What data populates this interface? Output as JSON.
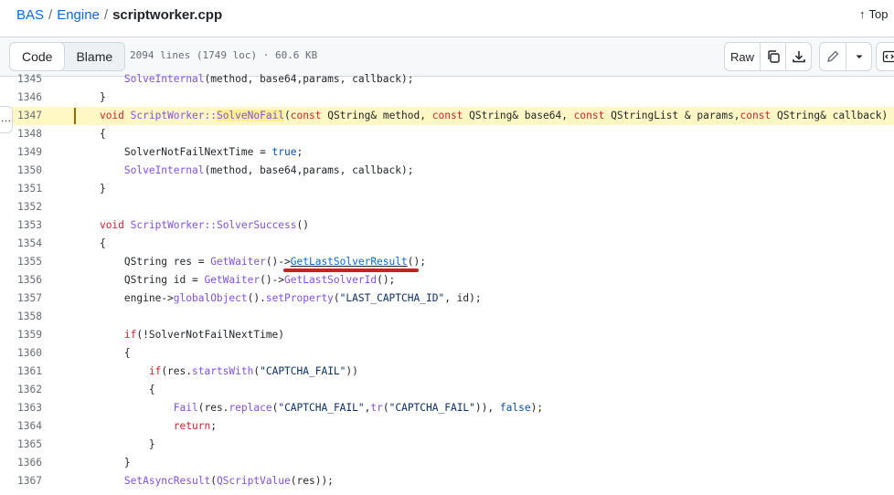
{
  "breadcrumb": {
    "repo": "BAS",
    "folder": "Engine",
    "file": "scriptworker.cpp",
    "separator": "/"
  },
  "top_link": {
    "label": "Top",
    "icon": "arrow-up-icon"
  },
  "file_header": {
    "tabs": [
      {
        "label": "Code",
        "active": true
      },
      {
        "label": "Blame",
        "active": false
      }
    ],
    "meta": "2094 lines (1749 loc) · 60.6 KB",
    "raw_label": "Raw",
    "icons": [
      "copy-icon",
      "download-icon",
      "pencil-icon",
      "chevron-down-icon",
      "code-symbols-icon"
    ]
  },
  "expander_label": "…",
  "colors": {
    "highlight_line": "#fff8c5",
    "keyword": "#cf222e",
    "function": "#8250df",
    "constant": "#0550ae",
    "string": "#0a3069",
    "annotation_underline": "#cc1f1f"
  },
  "code": {
    "highlighted_line": 1347,
    "lines": [
      {
        "n": 1345,
        "indent": 2,
        "tokens": [
          [
            "f",
            "SolveInternal"
          ],
          [
            "",
            "(method, base64,params, callback);"
          ]
        ]
      },
      {
        "n": 1346,
        "indent": 1,
        "tokens": [
          [
            "",
            "}"
          ]
        ]
      },
      {
        "n": 1347,
        "indent": 1,
        "tokens": [
          [
            "k",
            "void"
          ],
          [
            "",
            " "
          ],
          [
            "f",
            "ScriptWorker::"
          ],
          [
            "fh",
            "SolveNoFail"
          ],
          [
            "",
            "("
          ],
          [
            "k",
            "const"
          ],
          [
            "",
            " QString& method, "
          ],
          [
            "k",
            "const"
          ],
          [
            "",
            " QString& base64, "
          ],
          [
            "k",
            "const"
          ],
          [
            "",
            " QStringList & params,"
          ],
          [
            "k",
            "const"
          ],
          [
            "",
            " QString& callback)"
          ]
        ]
      },
      {
        "n": 1348,
        "indent": 1,
        "tokens": [
          [
            "",
            "{"
          ]
        ]
      },
      {
        "n": 1349,
        "indent": 2,
        "tokens": [
          [
            "",
            "SolverNotFailNextTime = "
          ],
          [
            "c",
            "true"
          ],
          [
            "",
            ";"
          ]
        ]
      },
      {
        "n": 1350,
        "indent": 2,
        "tokens": [
          [
            "f",
            "SolveInternal"
          ],
          [
            "",
            "(method, base64,params, callback);"
          ]
        ]
      },
      {
        "n": 1351,
        "indent": 1,
        "tokens": [
          [
            "",
            "}"
          ]
        ]
      },
      {
        "n": 1352,
        "indent": 0,
        "tokens": []
      },
      {
        "n": 1353,
        "indent": 1,
        "tokens": [
          [
            "k",
            "void"
          ],
          [
            "",
            " "
          ],
          [
            "f",
            "ScriptWorker::SolverSuccess"
          ],
          [
            "",
            "()"
          ]
        ]
      },
      {
        "n": 1354,
        "indent": 1,
        "tokens": [
          [
            "",
            "{"
          ]
        ]
      },
      {
        "n": 1355,
        "indent": 2,
        "tokens": [
          [
            "",
            "QString res = "
          ],
          [
            "f",
            "GetWaiter"
          ],
          [
            "",
            "()->"
          ],
          [
            "link",
            "GetLastSolverResult"
          ],
          [
            "",
            "();"
          ]
        ]
      },
      {
        "n": 1356,
        "indent": 2,
        "tokens": [
          [
            "",
            "QString id = "
          ],
          [
            "f",
            "GetWaiter"
          ],
          [
            "",
            "()->"
          ],
          [
            "f",
            "GetLastSolverId"
          ],
          [
            "",
            "();"
          ]
        ]
      },
      {
        "n": 1357,
        "indent": 2,
        "tokens": [
          [
            "",
            "engine->"
          ],
          [
            "f",
            "globalObject"
          ],
          [
            "",
            "()."
          ],
          [
            "f",
            "setProperty"
          ],
          [
            "",
            "("
          ],
          [
            "s",
            "\"LAST_CAPTCHA_ID\""
          ],
          [
            "",
            ", id);"
          ]
        ]
      },
      {
        "n": 1358,
        "indent": 0,
        "tokens": []
      },
      {
        "n": 1359,
        "indent": 2,
        "tokens": [
          [
            "k",
            "if"
          ],
          [
            "",
            "(!SolverNotFailNextTime)"
          ]
        ]
      },
      {
        "n": 1360,
        "indent": 2,
        "tokens": [
          [
            "",
            "{"
          ]
        ]
      },
      {
        "n": 1361,
        "indent": 3,
        "tokens": [
          [
            "k",
            "if"
          ],
          [
            "",
            "(res."
          ],
          [
            "f",
            "startsWith"
          ],
          [
            "",
            "("
          ],
          [
            "s",
            "\"CAPTCHA_FAIL\""
          ],
          [
            "",
            "))"
          ]
        ]
      },
      {
        "n": 1362,
        "indent": 3,
        "tokens": [
          [
            "",
            "{"
          ]
        ]
      },
      {
        "n": 1363,
        "indent": 4,
        "tokens": [
          [
            "f",
            "Fail"
          ],
          [
            "",
            "(res."
          ],
          [
            "f",
            "replace"
          ],
          [
            "",
            "("
          ],
          [
            "s",
            "\"CAPTCHA_FAIL\""
          ],
          [
            "",
            ","
          ],
          [
            "f",
            "tr"
          ],
          [
            "",
            "("
          ],
          [
            "s",
            "\"CAPTCHA_FAIL\""
          ],
          [
            "",
            "))"
          ],
          [
            "",
            ", "
          ],
          [
            "c",
            "false"
          ],
          [
            "",
            ");"
          ]
        ]
      },
      {
        "n": 1364,
        "indent": 4,
        "tokens": [
          [
            "k",
            "return"
          ],
          [
            "",
            ";"
          ]
        ]
      },
      {
        "n": 1365,
        "indent": 3,
        "tokens": [
          [
            "",
            "}"
          ]
        ]
      },
      {
        "n": 1366,
        "indent": 2,
        "tokens": [
          [
            "",
            "}"
          ]
        ]
      },
      {
        "n": 1367,
        "indent": 2,
        "tokens": [
          [
            "f",
            "SetAsyncResult"
          ],
          [
            "",
            "("
          ],
          [
            "f",
            "QScriptValue"
          ],
          [
            "",
            "(res));"
          ]
        ]
      }
    ]
  }
}
